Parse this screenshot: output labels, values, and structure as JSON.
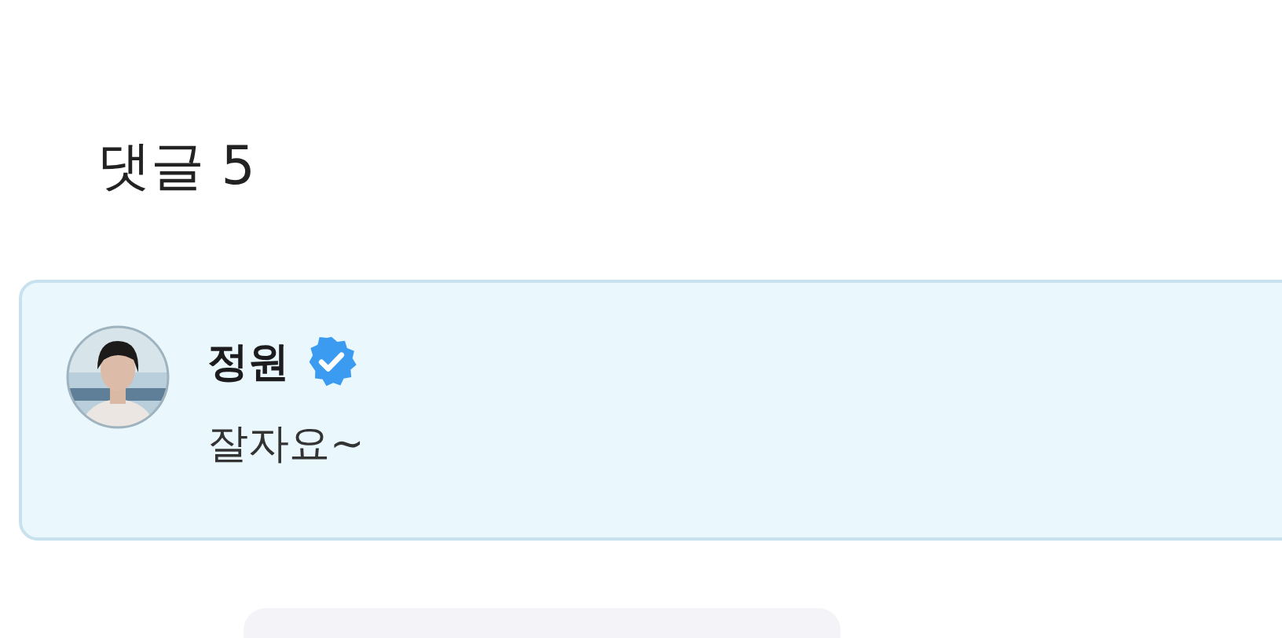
{
  "comments_title": "댓글 5",
  "comments": [
    {
      "author": "정원",
      "verified": true,
      "text": "잘자요~",
      "highlighted": true
    }
  ]
}
